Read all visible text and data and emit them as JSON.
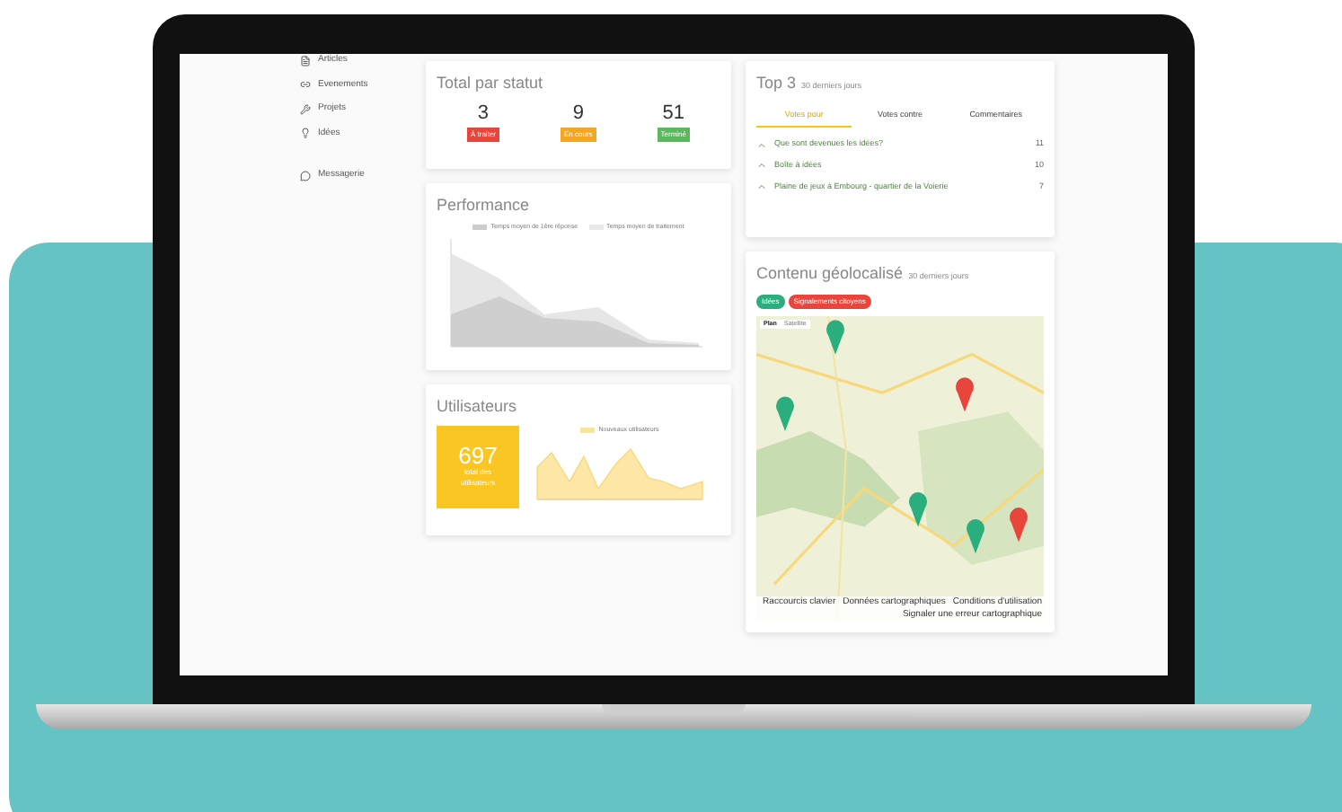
{
  "sidebar": {
    "items": [
      {
        "label": "Articles"
      },
      {
        "label": "Evenements"
      },
      {
        "label": "Projets"
      },
      {
        "label": "Idées"
      },
      {
        "label": "Messagerie"
      }
    ]
  },
  "status_card": {
    "title": "Total par statut",
    "stats": [
      {
        "value": "3",
        "label": "À traiter",
        "color": "#e8453c"
      },
      {
        "value": "9",
        "label": "En cours",
        "color": "#f5a623"
      },
      {
        "value": "51",
        "label": "Terminé",
        "color": "#5cb85c"
      }
    ]
  },
  "performance": {
    "title": "Performance",
    "legend": [
      "Temps moyen de 1ère réponse",
      "Temps moyen de traitement"
    ]
  },
  "users": {
    "title": "Utilisateurs",
    "total": "697",
    "total_label": "total des utilisateurs",
    "legend": "Nouveaux utilisateurs"
  },
  "top3": {
    "title": "Top 3",
    "subtitle": "30 derniers jours",
    "tabs": [
      {
        "label": "Votes pour",
        "selected": true
      },
      {
        "label": "Votes contre",
        "selected": false
      },
      {
        "label": "Commentaires",
        "selected": false
      }
    ],
    "rows": [
      {
        "title": "Que sont devenues les idées?",
        "count": "11"
      },
      {
        "title": "Boîte à idées",
        "count": "10"
      },
      {
        "title": "Plaine de jeux à Embourg - quartier de la Voierie",
        "count": "7"
      }
    ]
  },
  "geo": {
    "title": "Contenu géolocalisé",
    "subtitle": "30 derniers jours",
    "tags": [
      {
        "label": "Idées",
        "color": "#2bae7e"
      },
      {
        "label": "Signalements citoyens",
        "color": "#e8453c"
      }
    ],
    "map": {
      "kind": "picture",
      "views": [
        {
          "label": "Plan",
          "selected": true
        },
        {
          "label": "Satellite",
          "selected": false
        }
      ],
      "footer": [
        "Raccourcis clavier",
        "Données cartographiques",
        "Conditions d'utilisation",
        "Signaler une erreur cartographique"
      ]
    }
  }
}
